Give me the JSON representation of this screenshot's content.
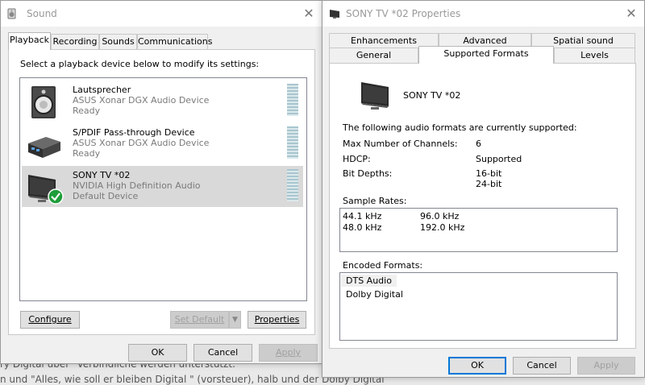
{
  "background": {
    "line1": "ry Digital über \"Verbindliche werden unterstützt.\"",
    "line2": "n und \"Alles, wie soll er bleiben Digital \" (vorsteuer), halb und der Dolby Digital"
  },
  "sound": {
    "title": "Sound",
    "tabs": [
      "Playback",
      "Recording",
      "Sounds",
      "Communications"
    ],
    "instruction": "Select a playback device below to modify its settings:",
    "devices": [
      {
        "name": "Lautsprecher",
        "driver": "ASUS Xonar DGX Audio Device",
        "status": "Ready",
        "icon": "speaker-icon"
      },
      {
        "name": "S/PDIF Pass-through Device",
        "driver": "ASUS Xonar DGX Audio Device",
        "status": "Ready",
        "icon": "spdif-device-icon"
      },
      {
        "name": "SONY TV  *02",
        "driver": "NVIDIA High Definition Audio",
        "status": "Default Device",
        "icon": "tv-monitor-icon",
        "selected": true,
        "default": true
      }
    ],
    "buttons": {
      "configure": "Configure",
      "set_default": "Set Default",
      "properties": "Properties",
      "ok": "OK",
      "cancel": "Cancel",
      "apply": "Apply"
    }
  },
  "props": {
    "title": "SONY TV  *02 Properties",
    "tabs_row1": [
      "Enhancements",
      "Advanced",
      "Spatial sound"
    ],
    "tabs_row2": [
      "General",
      "Supported Formats",
      "Levels"
    ],
    "device_name": "SONY TV  *02",
    "heading": "The following audio formats are currently supported:",
    "channels_label": "Max Number of Channels:",
    "channels_value": "6",
    "hdcp_label": "HDCP:",
    "hdcp_value": "Supported",
    "bitdepths_label": "Bit Depths:",
    "bitdepths": [
      "16-bit",
      "24-bit"
    ],
    "sample_rates_label": "Sample Rates:",
    "sample_rates": [
      "44.1 kHz",
      "96.0 kHz",
      "48.0 kHz",
      "192.0 kHz"
    ],
    "encoded_label": "Encoded Formats:",
    "encoded_formats": [
      "DTS Audio",
      "Dolby Digital"
    ],
    "buttons": {
      "ok": "OK",
      "cancel": "Cancel",
      "apply": "Apply"
    }
  }
}
